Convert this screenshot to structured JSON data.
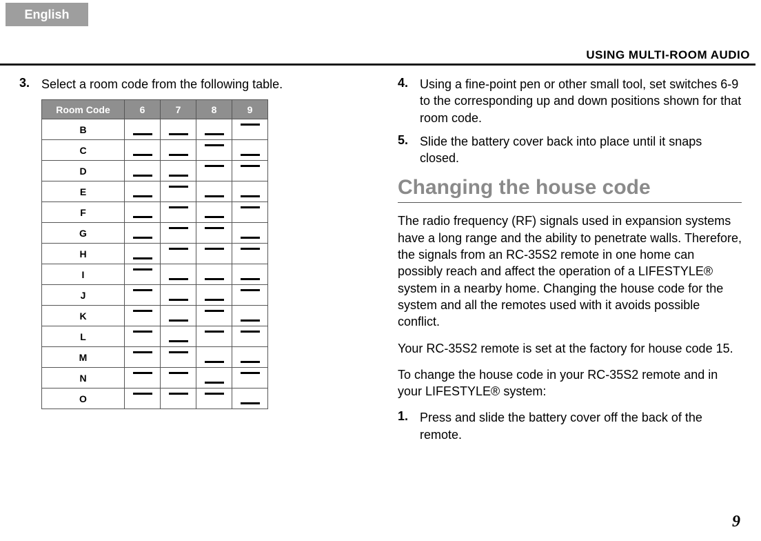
{
  "lang_tab": "English",
  "header": "USING MULTI-ROOM AUDIO",
  "left": {
    "step3_num": "3.",
    "step3_text": "Select a room code from the following table."
  },
  "table": {
    "head_room": "Room Code",
    "head_6": "6",
    "head_7": "7",
    "head_8": "8",
    "head_9": "9",
    "rows": [
      {
        "code": "B",
        "sw": [
          "down",
          "down",
          "down",
          "up"
        ]
      },
      {
        "code": "C",
        "sw": [
          "down",
          "down",
          "up",
          "down"
        ]
      },
      {
        "code": "D",
        "sw": [
          "down",
          "down",
          "up",
          "up"
        ]
      },
      {
        "code": "E",
        "sw": [
          "down",
          "up",
          "down",
          "down"
        ]
      },
      {
        "code": "F",
        "sw": [
          "down",
          "up",
          "down",
          "up"
        ]
      },
      {
        "code": "G",
        "sw": [
          "down",
          "up",
          "up",
          "down"
        ]
      },
      {
        "code": "H",
        "sw": [
          "down",
          "up",
          "up",
          "up"
        ]
      },
      {
        "code": "I",
        "sw": [
          "up",
          "down",
          "down",
          "down"
        ]
      },
      {
        "code": "J",
        "sw": [
          "up",
          "down",
          "down",
          "up"
        ]
      },
      {
        "code": "K",
        "sw": [
          "up",
          "down",
          "up",
          "down"
        ]
      },
      {
        "code": "L",
        "sw": [
          "up",
          "down",
          "up",
          "up"
        ]
      },
      {
        "code": "M",
        "sw": [
          "up",
          "up",
          "down",
          "down"
        ]
      },
      {
        "code": "N",
        "sw": [
          "up",
          "up",
          "down",
          "up"
        ]
      },
      {
        "code": "O",
        "sw": [
          "up",
          "up",
          "up",
          "down"
        ]
      }
    ]
  },
  "right": {
    "step4_num": "4.",
    "step4_text": "Using a fine-point pen or other small tool, set switches 6-9 to the corresponding up and down positions shown for that room code.",
    "step5_num": "5.",
    "step5_text": "Slide the battery cover back into place until it snaps closed.",
    "section_head": "Changing the house code",
    "para1": "The radio frequency (RF) signals used in expansion systems have a long range and the ability to penetrate walls. Therefore, the signals from an RC-35S2 remote in one home can possibly reach and affect the operation of a LIFESTYLE® system in a nearby home. Changing the house code for the system and all the remotes used with it avoids possible conflict.",
    "para2": "Your RC-35S2 remote is set at the factory for house code 15.",
    "para3": "To change the house code in your RC-35S2 remote and in your LIFESTYLE® system:",
    "step1_num": "1.",
    "step1_text": "Press and slide the battery cover off the back of the remote."
  },
  "page_number": "9"
}
